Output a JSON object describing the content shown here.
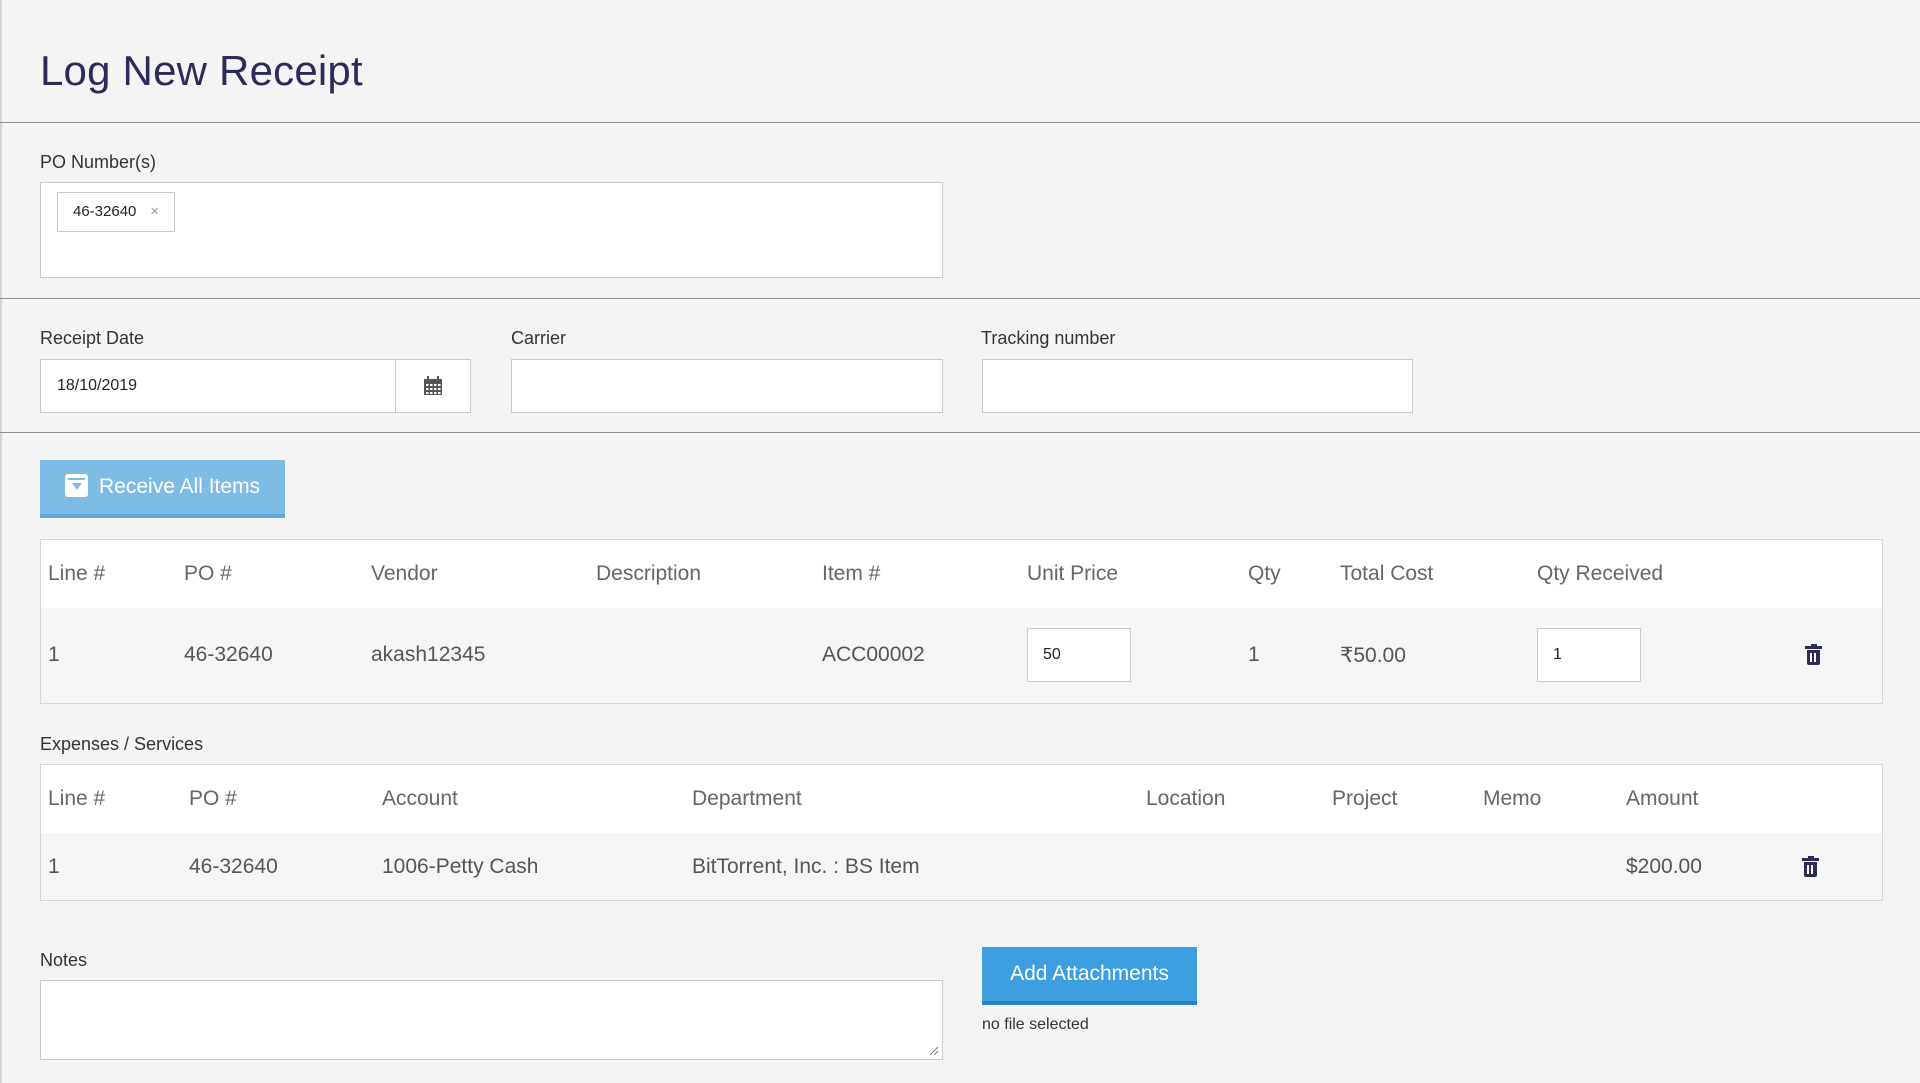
{
  "page": {
    "title": "Log New Receipt"
  },
  "po": {
    "label": "PO Number(s)",
    "tags": [
      "46-32640"
    ],
    "tag_remove": "×"
  },
  "receipt_date": {
    "label": "Receipt Date",
    "value": "18/10/2019"
  },
  "carrier": {
    "label": "Carrier",
    "value": ""
  },
  "tracking": {
    "label": "Tracking number",
    "value": ""
  },
  "receive_all": {
    "label": "Receive All Items",
    "icon": "download-box-icon"
  },
  "items": {
    "headers": [
      "Line #",
      "PO #",
      "Vendor",
      "Description",
      "Item #",
      "Unit Price",
      "Qty",
      "Total Cost",
      "Qty Received"
    ],
    "rows": [
      {
        "line": "1",
        "po": "46-32640",
        "vendor": "akash12345",
        "description": "",
        "item": "ACC00002",
        "unit_price": "50",
        "qty": "1",
        "total_cost": "₹50.00",
        "qty_received": "1"
      }
    ]
  },
  "expenses": {
    "label": "Expenses / Services",
    "headers": [
      "Line #",
      "PO #",
      "Account",
      "Department",
      "Location",
      "Project",
      "Memo",
      "Amount"
    ],
    "rows": [
      {
        "line": "1",
        "po": "46-32640",
        "account": "1006-Petty Cash",
        "department": "BitTorrent, Inc. : BS Item",
        "location": "",
        "project": "",
        "memo": "",
        "amount": "$200.00"
      }
    ]
  },
  "notes": {
    "label": "Notes",
    "value": ""
  },
  "attachments": {
    "button": "Add Attachments",
    "status": "no file selected"
  }
}
